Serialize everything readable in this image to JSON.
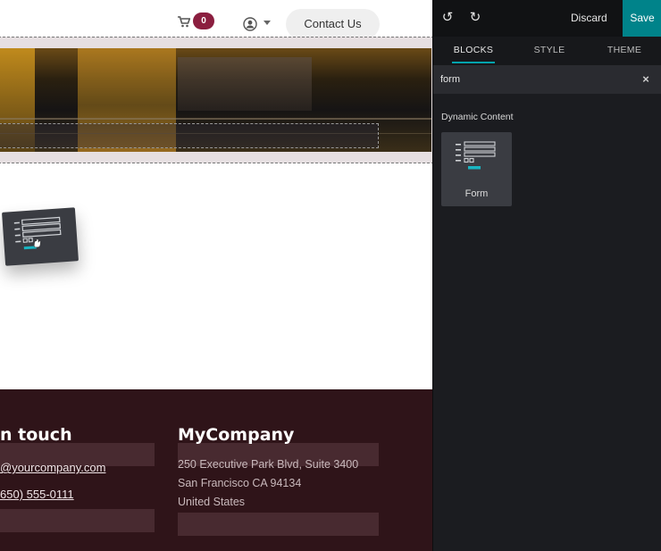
{
  "header": {
    "cart_count": "0",
    "contact_label": "Contact Us",
    "icons": [
      "cart-icon",
      "user-icon",
      "chevron-down-icon"
    ]
  },
  "footer": {
    "col1": {
      "title": "n touch",
      "email": "@yourcompany.com",
      "phone": "650) 555-0111"
    },
    "col2": {
      "title": "MyCompany",
      "address_line1": "250 Executive Park Blvd, Suite 3400",
      "address_line2": "San Francisco CA 94134",
      "address_line3": "United States"
    }
  },
  "editor": {
    "discard_label": "Discard",
    "save_label": "Save",
    "tabs": [
      {
        "label": "BLOCKS",
        "active": true
      },
      {
        "label": "STYLE",
        "active": false
      },
      {
        "label": "THEME",
        "active": false
      }
    ],
    "search": {
      "value": "form",
      "clear_icon": "close-icon"
    },
    "category": "Dynamic Content",
    "blocks": [
      {
        "label": "Form",
        "icon": "form-icon"
      }
    ],
    "accent_color": "#00838a"
  }
}
